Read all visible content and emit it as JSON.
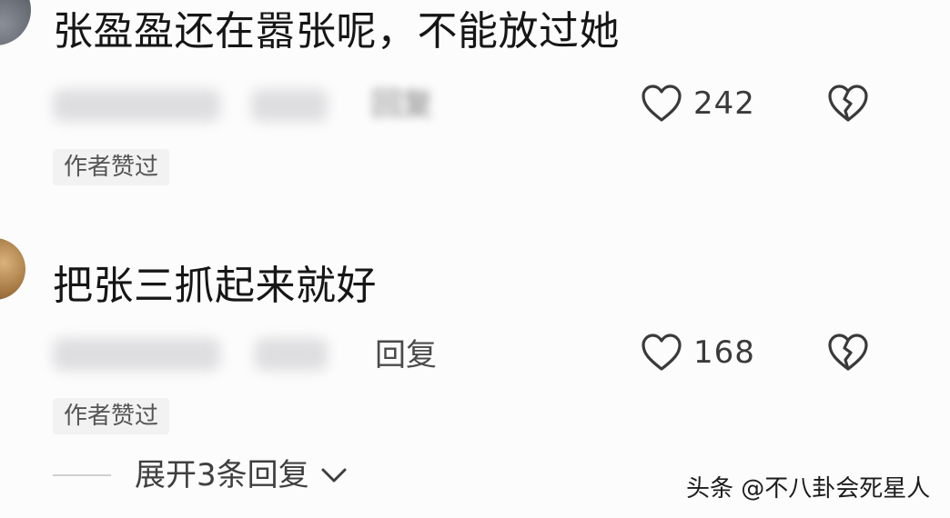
{
  "comments": [
    {
      "text": "张盈盈还在嚣张呢，不能放过她",
      "reply_label": "回复",
      "likes": "242",
      "author_badge": "作者赞过"
    },
    {
      "text": "把张三抓起来就好",
      "reply_label": "回复",
      "likes": "168",
      "author_badge": "作者赞过"
    }
  ],
  "expand": {
    "label": "展开3条回复"
  },
  "watermark": "头条 @不八卦会死星人",
  "icons": {
    "like": "heart-outline-icon",
    "dislike": "broken-heart-icon",
    "expand": "chevron-down-icon"
  },
  "colors": {
    "text": "#161616",
    "muted": "#4a4a4a",
    "badge_bg": "#f2f2f2",
    "icon_stroke": "#3a3a3a"
  }
}
